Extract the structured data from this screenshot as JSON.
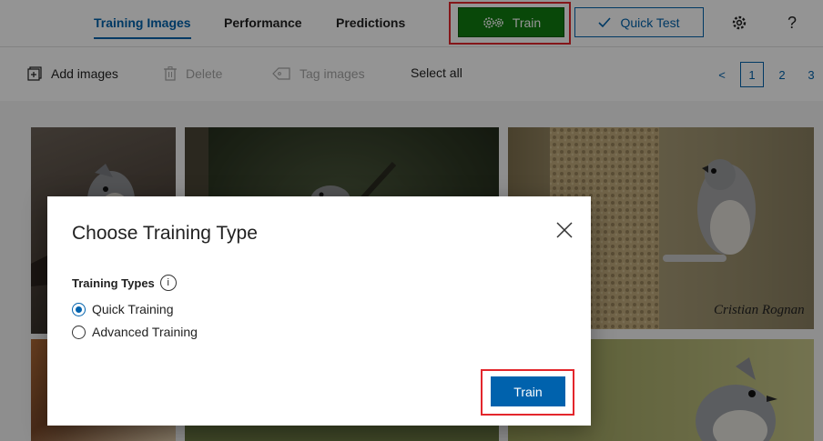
{
  "nav": {
    "tabs": [
      {
        "label": "Training Images",
        "active": true
      },
      {
        "label": "Performance",
        "active": false
      },
      {
        "label": "Predictions",
        "active": false
      }
    ],
    "train_label": "Train",
    "quick_test_label": "Quick Test",
    "settings_icon": "gear-icon",
    "help_label": "?"
  },
  "toolbar": {
    "add_images": "Add images",
    "delete": "Delete",
    "tag_images": "Tag images",
    "select_all": "Select all",
    "pager": {
      "prev": "<",
      "pages": [
        "1",
        "2",
        "3"
      ],
      "current": "1"
    }
  },
  "dialog": {
    "title": "Choose Training Type",
    "types_label": "Training Types",
    "info_icon_label": "i",
    "options": [
      {
        "label": "Quick Training",
        "selected": true
      },
      {
        "label": "Advanced Training",
        "selected": false
      }
    ],
    "train_button": "Train"
  },
  "colors": {
    "accent_blue": "#0062ad",
    "train_green": "#107c10",
    "highlight_red": "#e3262c"
  }
}
